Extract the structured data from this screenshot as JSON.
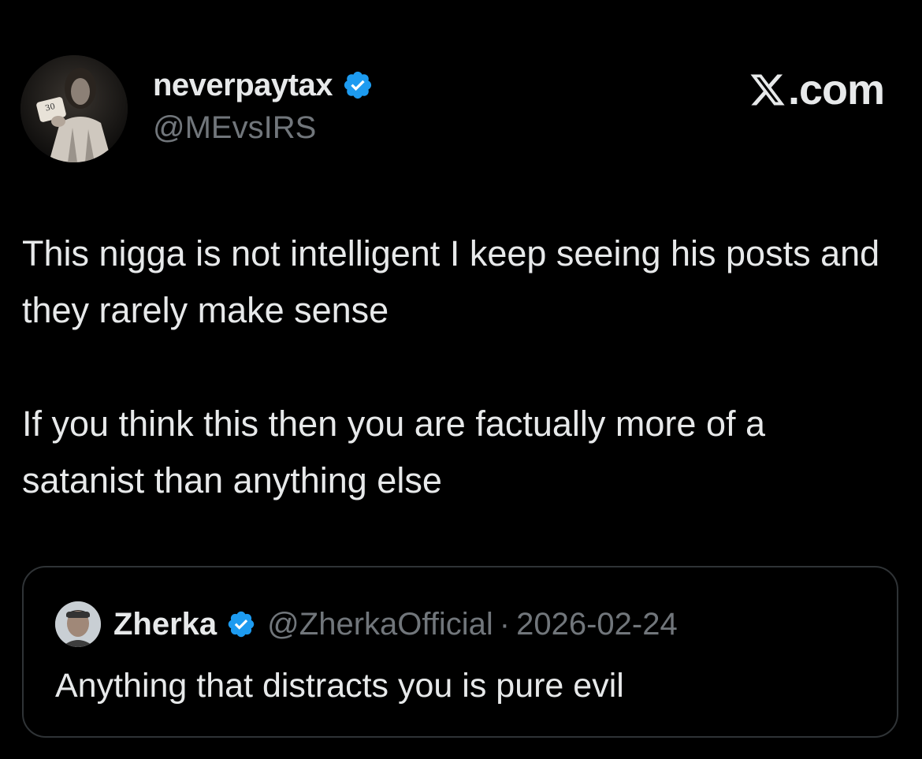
{
  "author": {
    "display_name": "neverpaytax",
    "handle": "@MEvsIRS",
    "verified": true,
    "avatar_icon": "profile-avatar-image"
  },
  "brand": {
    "logo_icon": "x-logo-icon",
    "text": ".com"
  },
  "tweet": {
    "paragraphs": [
      "This nigga is not intelligent I keep seeing his posts and they rarely make sense",
      "If you think this then you are factually more of a satanist than anything else"
    ]
  },
  "quoted_tweet": {
    "display_name": "Zherka",
    "handle": "@ZherkaOfficial",
    "separator": "·",
    "date": "2026-02-24",
    "verified": true,
    "text": "Anything that distracts you is pure evil"
  },
  "colors": {
    "background": "#000000",
    "primary_text": "#e7e9ea",
    "secondary_text": "#71767b",
    "verified_badge": "#1d9bf0",
    "border": "#2f3336"
  }
}
